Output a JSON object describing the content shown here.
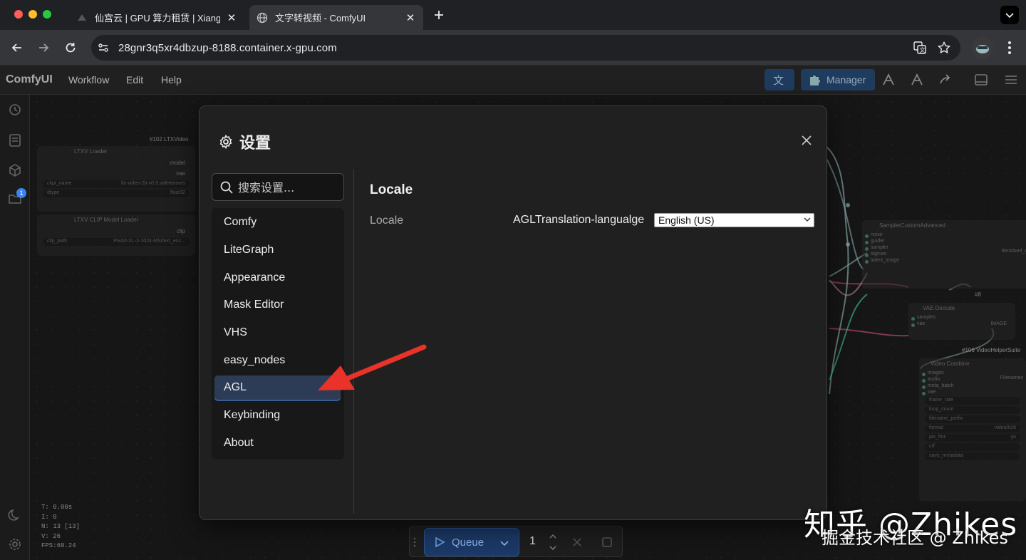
{
  "browser": {
    "tabs": [
      {
        "title": "仙宫云 | GPU 算力租赁 | Xiang",
        "active": false
      },
      {
        "title": "文字转视频 - ComfyUI",
        "active": true
      }
    ],
    "url": "28gnr3q5xr4dbzup-8188.container.x-gpu.com",
    "new_tab_icon": "plus-icon"
  },
  "app": {
    "logo": "ComfyUI",
    "menu": [
      "Workflow",
      "Edit",
      "Help"
    ],
    "manager_label": "Manager"
  },
  "canvas": {
    "nodes": {
      "ltxv_loader": {
        "id_tag": "#102 LTXVideo",
        "title": "LTXV Loader",
        "outputs": [
          "model",
          "vae"
        ],
        "widgets": [
          {
            "name": "ckpt_name",
            "value": "ltx-video-2b-v0.9.safetensors"
          },
          {
            "name": "dtype",
            "value": "float32"
          }
        ]
      },
      "clip_loader": {
        "title": "LTXV CLIP Model Loader",
        "outputs": [
          "clip"
        ],
        "widgets": [
          {
            "name": "clip_path",
            "value": "PixArt-XL-2-1024-MS/text_enc..."
          }
        ]
      },
      "sampler": {
        "title": "SamplerCustomAdvanced",
        "inputs": [
          "noise",
          "guider",
          "sampler",
          "sigmas",
          "latent_image"
        ],
        "outputs": [
          "denoised_o"
        ]
      },
      "vae_decode": {
        "id_tag": "#8",
        "title": "VAE Decode",
        "inputs": [
          "samples",
          "vae"
        ],
        "outputs": [
          "IMAGE"
        ]
      },
      "video_combine": {
        "id_tag": "#106 VideoHelperSuite",
        "title": "Video Combine",
        "inputs": [
          "images",
          "audio",
          "meta_batch",
          "vae"
        ],
        "outputs": [
          "Filenames"
        ],
        "widgets": [
          "frame_rate",
          "loop_count",
          "filename_prefix",
          "format",
          "pix_fmt",
          "crf",
          "save_metadata"
        ],
        "format_value": "video/h26",
        "pixfmt_value": "yu"
      }
    },
    "stats": [
      "T: 0.00s",
      "I: 0",
      "N: 13 [13]",
      "V: 26",
      "FPS:60.24"
    ]
  },
  "settings_modal": {
    "title": "设置",
    "search_placeholder": "搜索设置...",
    "categories": [
      "Comfy",
      "LiteGraph",
      "Appearance",
      "Mask Editor",
      "VHS",
      "easy_nodes",
      "AGL",
      "Keybinding",
      "About"
    ],
    "active_category": "AGL",
    "section_title": "Locale",
    "row_label": "Locale",
    "setting_key": "AGLTranslation-langualge",
    "setting_value": "English (US)"
  },
  "queue": {
    "label": "Queue",
    "count": "1"
  },
  "watermark": {
    "line1": "知乎 @Zhikes",
    "line2": "掘金技术社区 @ Zhikes"
  },
  "colors": {
    "accent": "#2c3c57",
    "queue_button": "#1c3a68",
    "arrow_annotation": "#e8322a",
    "badge": "#3b82f6"
  }
}
